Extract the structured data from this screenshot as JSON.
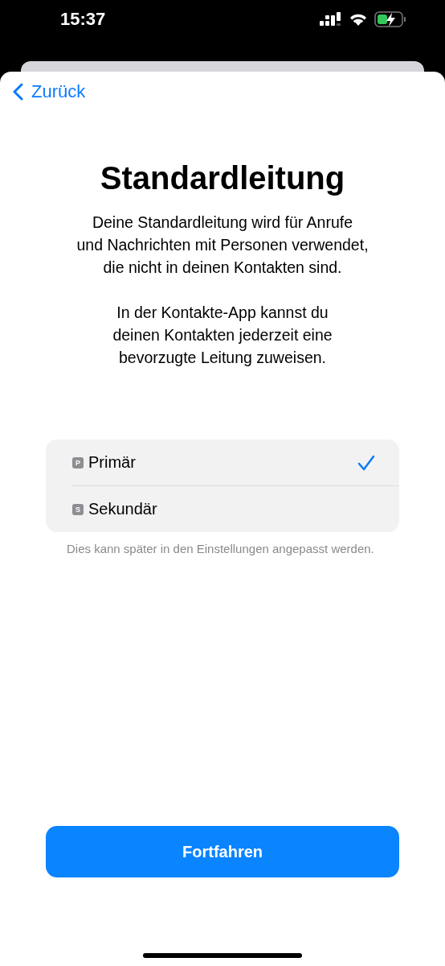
{
  "status_bar": {
    "time": "15:37"
  },
  "nav": {
    "back_label": "Zurück"
  },
  "title": "Standardleitung",
  "paragraphs": [
    "Deine Standardleitung wird für Anrufe\nund Nachrichten mit Personen verwendet,\ndie nicht in deinen Kontakten sind.",
    "In der Kontakte-App kannst du\ndeinen Kontakten jederzeit eine\nbevorzugte Leitung zuweisen."
  ],
  "options": [
    {
      "badge": "P",
      "label": "Primär",
      "selected": true
    },
    {
      "badge": "S",
      "label": "Sekundär",
      "selected": false
    }
  ],
  "footnote": "Dies kann später in den Einstellungen angepasst werden.",
  "button": "Fortfahren"
}
